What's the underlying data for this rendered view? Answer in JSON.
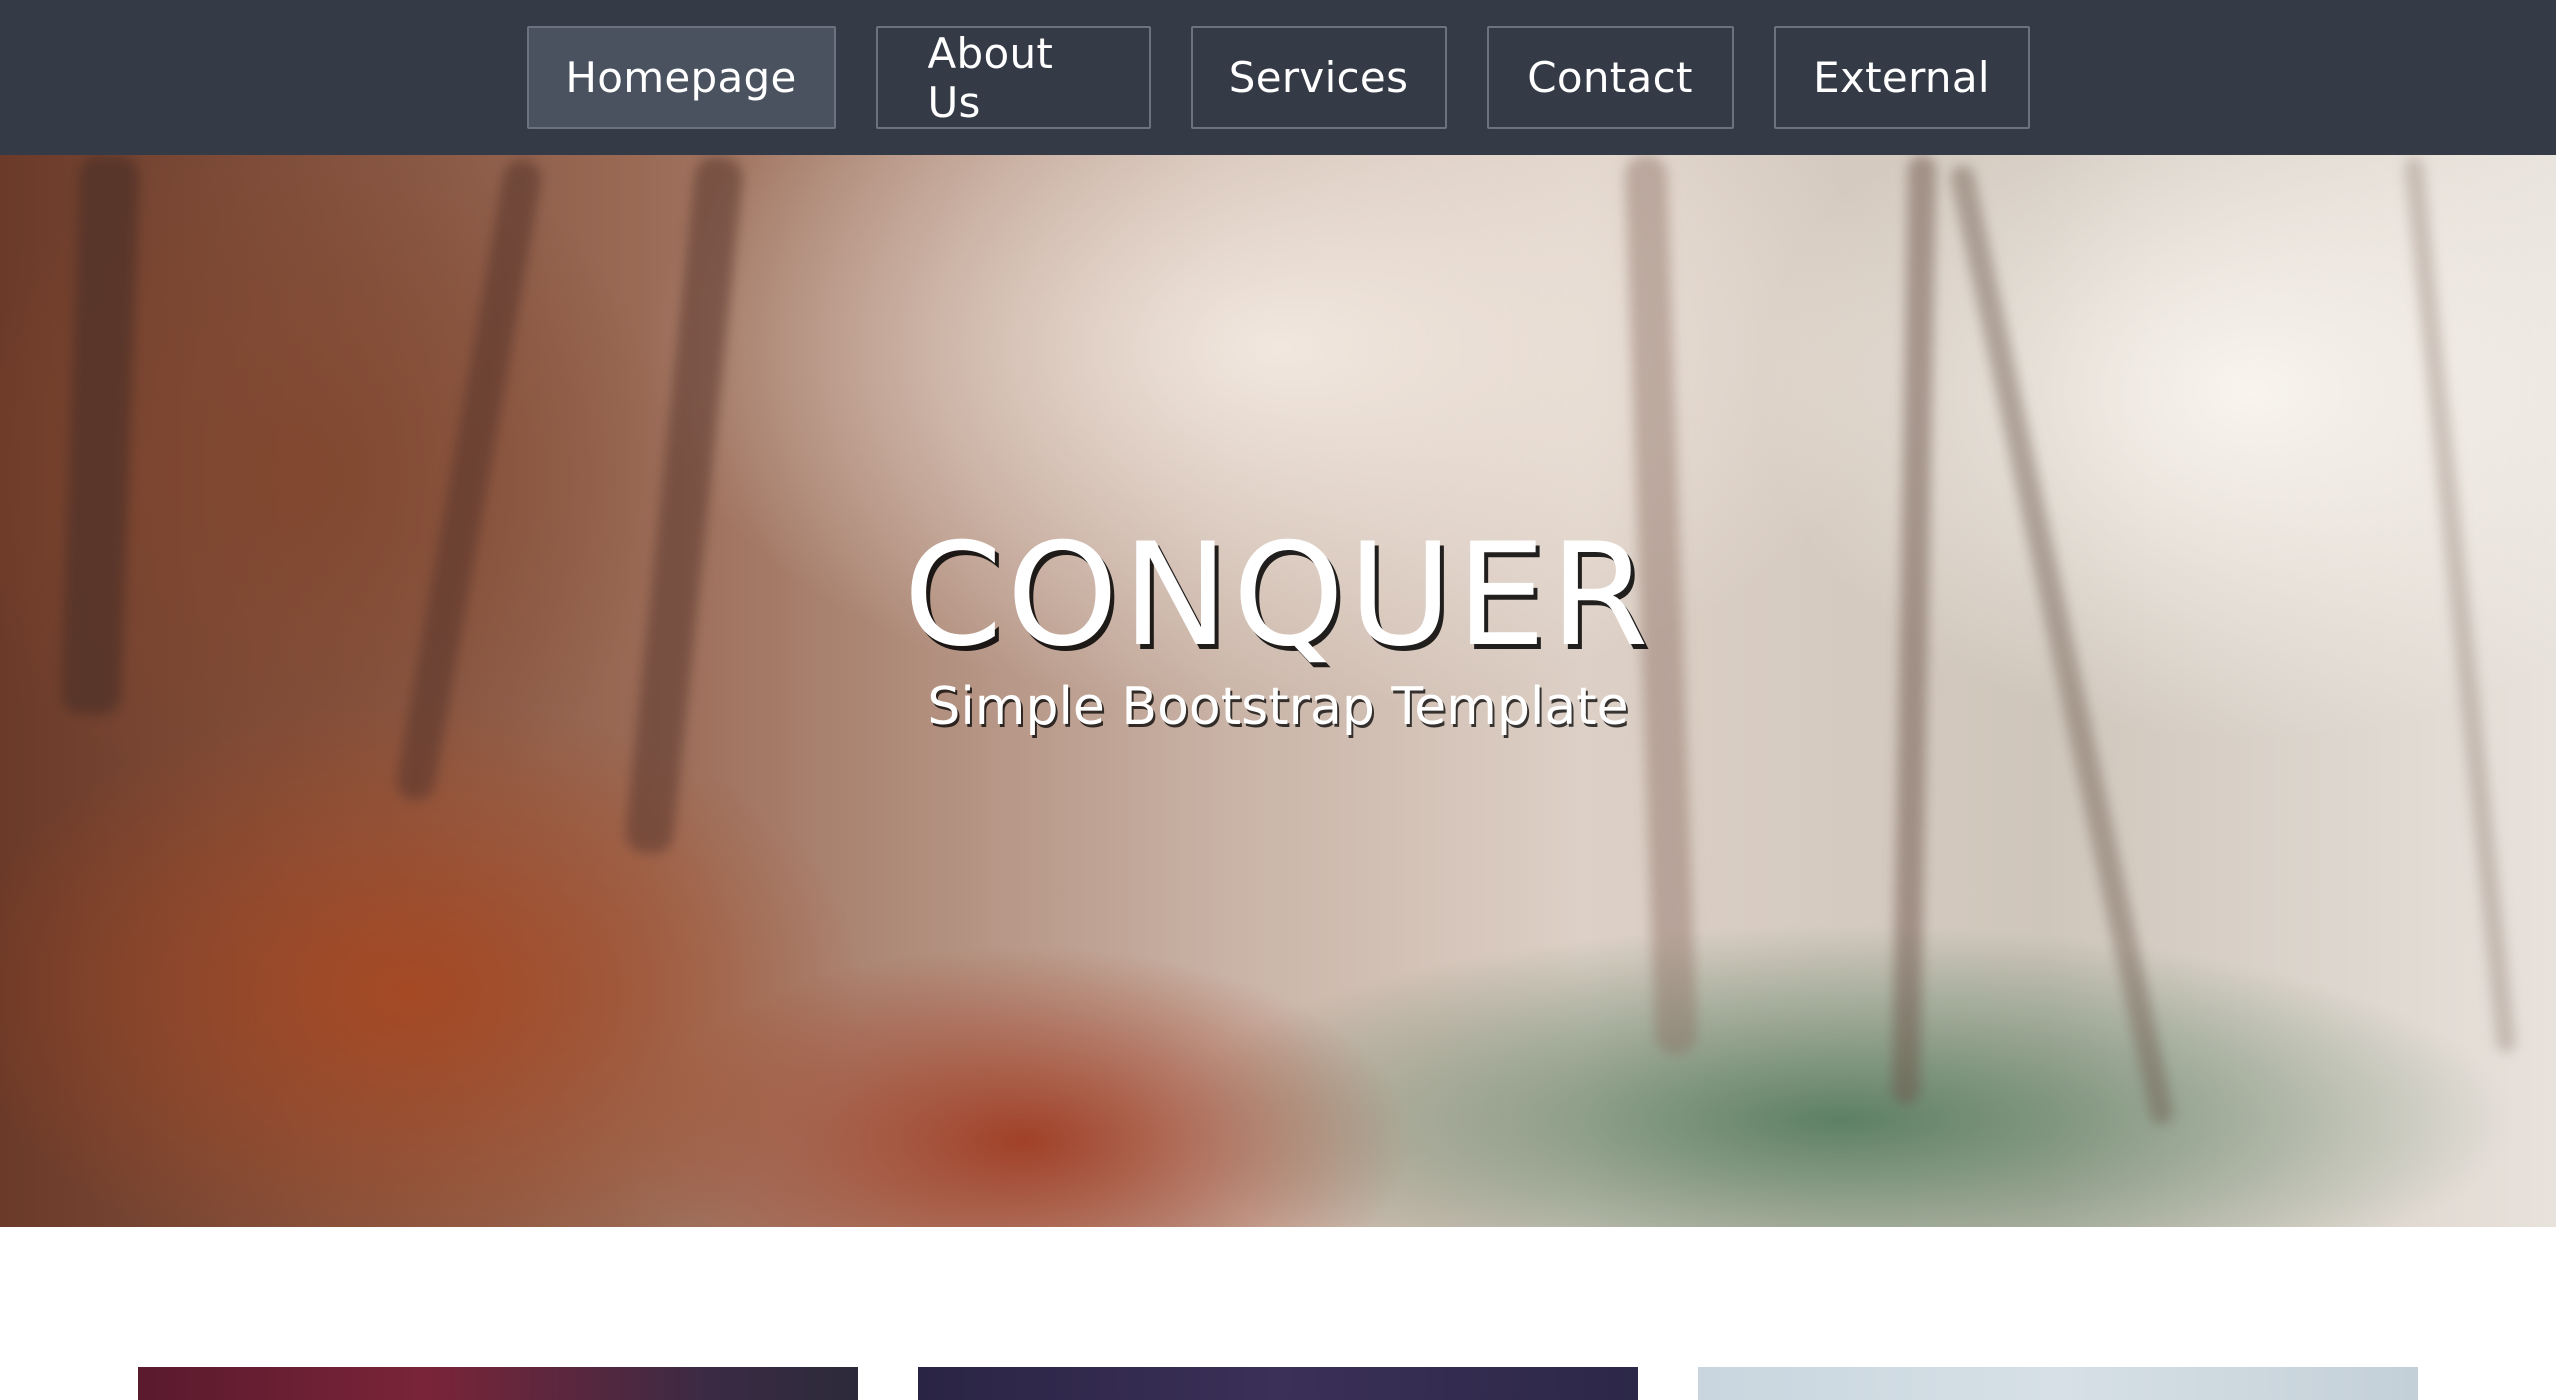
{
  "nav": {
    "items": [
      {
        "label": "Homepage",
        "active": true
      },
      {
        "label": "About Us",
        "active": false
      },
      {
        "label": "Services",
        "active": false
      },
      {
        "label": "Contact",
        "active": false
      },
      {
        "label": "External",
        "active": false
      }
    ]
  },
  "hero": {
    "title": "CONQUER",
    "subtitle": "Simple Bootstrap Template"
  },
  "colors": {
    "navbar_bg": "#343a46",
    "active_nav_bg": "#4a525f",
    "text": "#ffffff"
  }
}
